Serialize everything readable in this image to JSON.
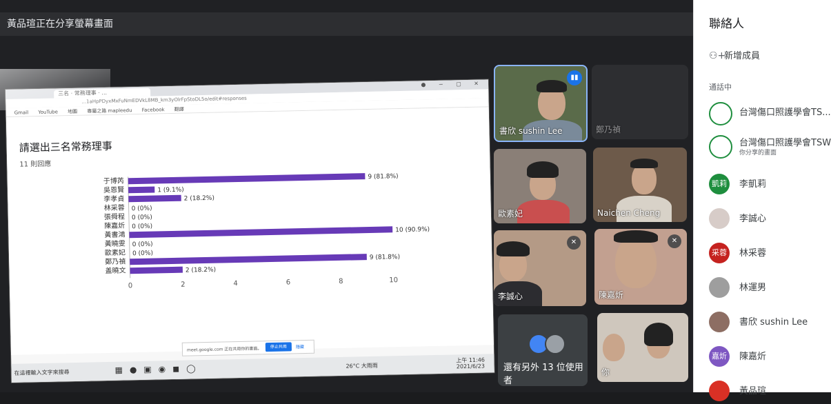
{
  "banner": {
    "text": "黃品瑄正在分享螢幕畫面"
  },
  "browser": {
    "tab_title": "三名 · 常務理事 · ...",
    "address": "...1aHpPDyxMxFuNmEDVkL8MB_km3yOlrFpStoDL5o/edit#responses",
    "bookmarks": [
      "Gmail",
      "YouTube",
      "地圖",
      "專屬之路 mapleedu",
      "Facebook",
      "翻譯"
    ]
  },
  "form": {
    "question": "請選出三名常務理事",
    "response_count": "11 則回應"
  },
  "chart_data": {
    "type": "bar",
    "orientation": "horizontal",
    "categories": [
      "于博芮",
      "吳恩賢",
      "李孝貞",
      "林采蓉",
      "張舜程",
      "陳嘉炘",
      "黃書鴻",
      "黃曉雯",
      "歐素妃",
      "鄭乃禎",
      "盖曉文"
    ],
    "values": [
      9,
      1,
      2,
      0,
      0,
      0,
      10,
      0,
      0,
      9,
      2
    ],
    "labels": [
      "9 (81.8%)",
      "1 (9.1%)",
      "2 (18.2%)",
      "0 (0%)",
      "0 (0%)",
      "0 (0%)",
      "10 (90.9%)",
      "0 (0%)",
      "0 (0%)",
      "9 (81.8%)",
      "2 (18.2%)"
    ],
    "xticks": [
      "0",
      "2",
      "4",
      "6",
      "8",
      "10"
    ],
    "xlim": [
      0,
      11
    ],
    "bar_color": "#673ab7"
  },
  "notice": {
    "text": "meet.google.com 正在共用你的畫面。",
    "stop": "停止共用",
    "hide": "隱藏"
  },
  "taskbar": {
    "search": "在這裡輸入文字來搜尋",
    "weather": "26°C 大雨雨",
    "time": "上午 11:46",
    "date": "2021/6/23"
  },
  "tiles": {
    "speaker": "書欣 sushin Lee",
    "faded": "鄭乃禎",
    "t2": "歐素妃",
    "t3": "Naichen Cheng",
    "t4": "李誠心",
    "t5": "陳嘉炘",
    "others": "還有另外 13 位使用者",
    "you": "你"
  },
  "sidebar": {
    "title": "聯絡人",
    "add": "新增成員",
    "section": "通話中",
    "people": [
      {
        "name": "台灣傷口照護學會TS... (",
        "sub": "",
        "initials": "",
        "color": "#ffffff"
      },
      {
        "name": "台灣傷口照護學會TSWC",
        "sub": "你分享的畫面",
        "initials": "",
        "color": "#ffffff"
      },
      {
        "name": "李凱莉",
        "sub": "",
        "initials": "凱莉",
        "color": "#1e8e3e"
      },
      {
        "name": "李誠心",
        "sub": "",
        "initials": "",
        "color": "#d7ccc8"
      },
      {
        "name": "林采蓉",
        "sub": "",
        "initials": "采蓉",
        "color": "#c5221f"
      },
      {
        "name": "林運男",
        "sub": "",
        "initials": "",
        "color": "#9e9e9e"
      },
      {
        "name": "書欣 sushin Lee",
        "sub": "",
        "initials": "",
        "color": "#8d6e63"
      },
      {
        "name": "陳嘉炘",
        "sub": "",
        "initials": "嘉炘",
        "color": "#7e57c2"
      },
      {
        "name": "黃品瑄",
        "sub": "",
        "initials": "",
        "color": "#d93025"
      }
    ]
  }
}
